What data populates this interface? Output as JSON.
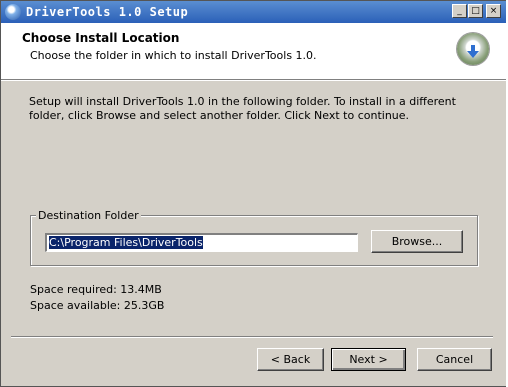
{
  "window": {
    "title": "DriverTools 1.0 Setup",
    "minimize_glyph": "_",
    "maximize_glyph": "□",
    "close_glyph": "×"
  },
  "header": {
    "title": "Choose Install Location",
    "subtitle": "Choose the folder in which to install DriverTools 1.0.",
    "logo_icon": "installer-globe-download-icon"
  },
  "body": {
    "instructions": "Setup will install DriverTools 1.0 in the following folder. To install in a different folder, click Browse and select another folder. Click Next to continue."
  },
  "destination": {
    "legend": "Destination Folder",
    "path": "C:\\Program Files\\DriverTools",
    "browse_label": "Browse..."
  },
  "space": {
    "required": "Space required: 13.4MB",
    "available": "Space available: 25.3GB"
  },
  "footer": {
    "back_label": "< Back",
    "next_label": "Next >",
    "cancel_label": "Cancel"
  },
  "colors": {
    "titlebar_start": "#5a8ed1",
    "titlebar_end": "#2b60b8",
    "dialog_bg": "#d4d0c8",
    "selection": "#0a246a"
  }
}
